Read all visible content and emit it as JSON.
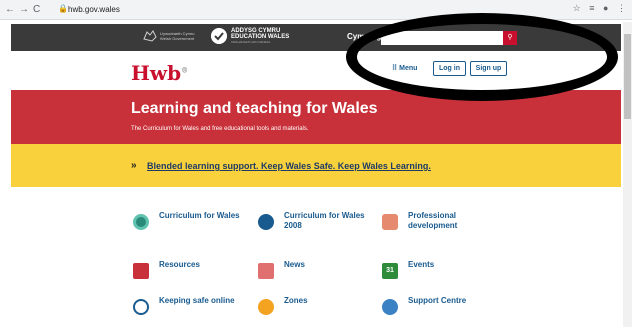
{
  "browser": {
    "url": "hwb.gov.wales"
  },
  "topbar": {
    "gov_logo_line1": "Llywodraeth Cymru",
    "gov_logo_line2": "Welsh Government",
    "edu_line1": "ADDYSG CYMRU",
    "edu_line2": "EDUCATION WALES",
    "edu_line3": "CENHADAETH EIN CENEDL",
    "language": "Cymraeg"
  },
  "header": {
    "logo": "Hwb",
    "logo_mark": "®",
    "menu_label": "Menu",
    "login_label": "Log in",
    "signup_label": "Sign up"
  },
  "hero": {
    "title": "Learning and teaching for Wales",
    "subtitle": "The Curriculum for Wales and free educational tools and materials."
  },
  "banner": {
    "arrow": "»",
    "link_text": "Blended learning support. Keep Wales Safe. Keep Wales Learning."
  },
  "tiles": [
    {
      "label": "Curriculum for Wales",
      "icon": "curriculum-icon"
    },
    {
      "label": "Curriculum for Wales 2008",
      "icon": "lightbulb-icon"
    },
    {
      "label": "Professional development",
      "icon": "tree-icon"
    },
    {
      "label": "Resources",
      "icon": "books-icon"
    },
    {
      "label": "News",
      "icon": "newspaper-icon"
    },
    {
      "label": "Events",
      "icon": "calendar-icon",
      "calendar_day": "31"
    },
    {
      "label": "Keeping safe online",
      "icon": "shield-icon"
    },
    {
      "label": "Zones",
      "icon": "puzzle-icon"
    },
    {
      "label": "Support Centre",
      "icon": "help-icon"
    }
  ],
  "colors": {
    "brand_red": "#c8102e",
    "hero_red": "#c8313a",
    "banner_yellow": "#f8d13c",
    "link_blue": "#1a5b8f"
  }
}
